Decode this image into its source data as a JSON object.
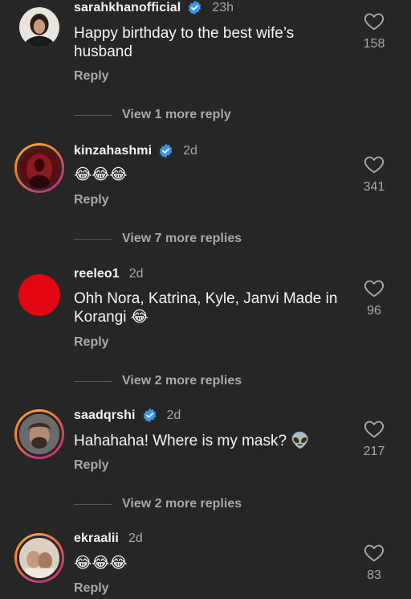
{
  "comments": [
    {
      "username": "sarahkhanofficial",
      "verified": true,
      "time": "23h",
      "text": "Happy birthday to the best wife’s husband",
      "reply_label": "Reply",
      "likes": "158",
      "view_more": "View 1 more reply"
    },
    {
      "username": "kinzahashmi",
      "verified": true,
      "time": "2d",
      "text": "😂😂😂",
      "reply_label": "Reply",
      "likes": "341",
      "view_more": "View 7 more replies"
    },
    {
      "username": "reeleo1",
      "verified": false,
      "time": "2d",
      "text": "Ohh Nora, Katrina, Kyle, Janvi Made in Korangi 😂",
      "reply_label": "Reply",
      "likes": "96",
      "view_more": "View 2 more replies"
    },
    {
      "username": "saadqrshi",
      "verified": true,
      "time": "2d",
      "text": "Hahahaha! Where is my mask? 👽",
      "reply_label": "Reply",
      "likes": "217",
      "view_more": "View 2 more replies"
    },
    {
      "username": "ekraalii",
      "verified": false,
      "time": "2d",
      "text": "😂😂😂",
      "reply_label": "Reply",
      "likes": "83"
    }
  ],
  "icons": {
    "like": "heart-outline-icon",
    "verified": "verified-badge-icon"
  },
  "colors": {
    "background": "#262626",
    "verified_blue": "#3897f0",
    "muted_text": "#a8a8a8"
  }
}
